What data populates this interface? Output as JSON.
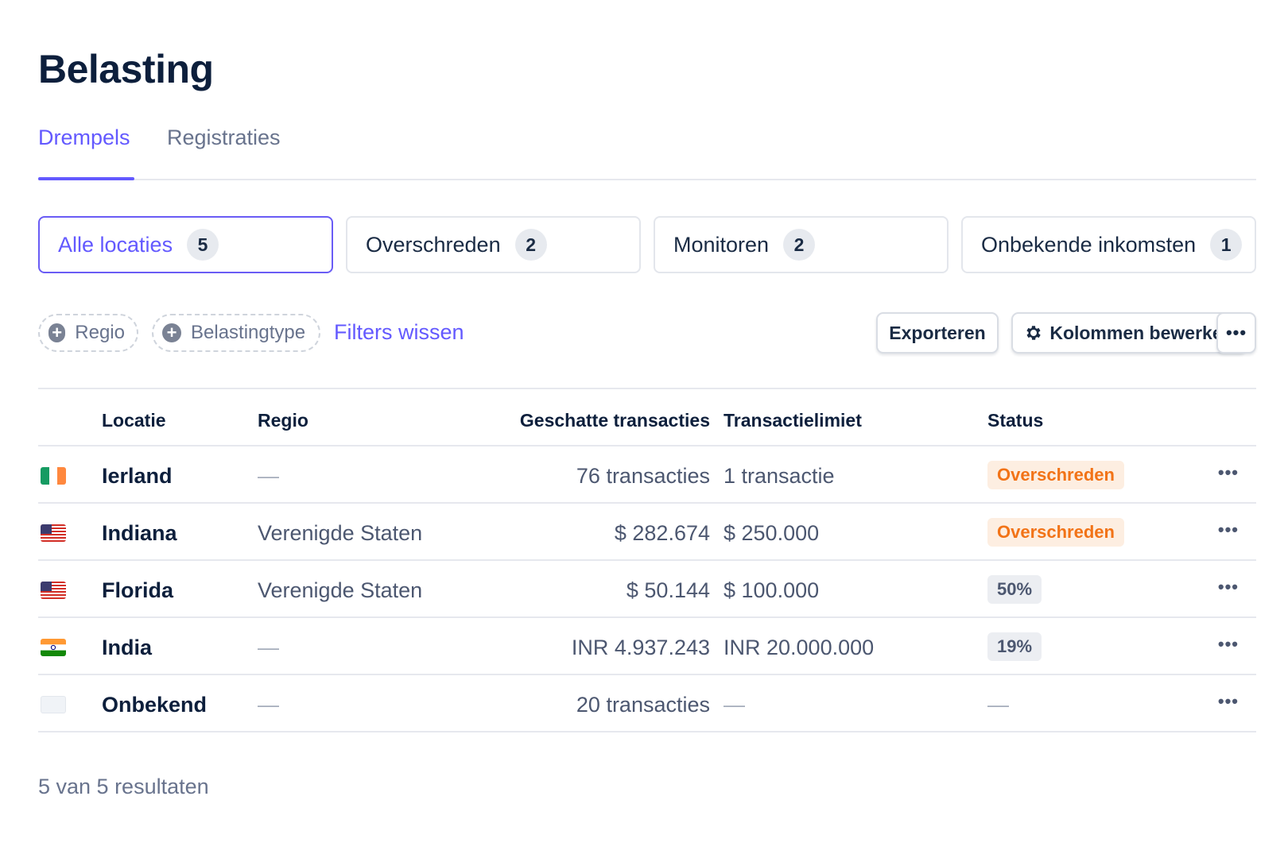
{
  "page": {
    "title": "Belasting"
  },
  "tabs": [
    {
      "label": "Drempels",
      "active": true
    },
    {
      "label": "Registraties",
      "active": false
    }
  ],
  "filter_cards": [
    {
      "label": "Alle locaties",
      "count": "5",
      "selected": true
    },
    {
      "label": "Overschreden",
      "count": "2",
      "selected": false
    },
    {
      "label": "Monitoren",
      "count": "2",
      "selected": false
    },
    {
      "label": "Onbekende inkomsten",
      "count": "1",
      "selected": false
    }
  ],
  "toolbar": {
    "chips": [
      {
        "label": "Regio",
        "icon": "plus-circle-icon"
      },
      {
        "label": "Belastingtype",
        "icon": "plus-circle-icon"
      }
    ],
    "clear_filters": "Filters wissen",
    "export_label": "Exporteren",
    "edit_columns_label": "Kolommen bewerken",
    "more_label": "•••"
  },
  "table": {
    "columns": [
      "Locatie",
      "Regio",
      "Geschatte transacties",
      "Transactielimiet",
      "Status"
    ],
    "rows": [
      {
        "flag": "ireland-flag-icon",
        "location": "Ierland",
        "region": "—",
        "estimated": "76 transacties",
        "limit": "1 transactie",
        "status": "Overschreden",
        "status_type": "exceeded"
      },
      {
        "flag": "us-flag-icon",
        "location": "Indiana",
        "region": "Verenigde Staten",
        "estimated": "$ 282.674",
        "limit": "$ 250.000",
        "status": "Overschreden",
        "status_type": "exceeded"
      },
      {
        "flag": "us-flag-icon",
        "location": "Florida",
        "region": "Verenigde Staten",
        "estimated": "$ 50.144",
        "limit": "$ 100.000",
        "status": "50%",
        "status_type": "pct"
      },
      {
        "flag": "india-flag-icon",
        "location": "India",
        "region": "—",
        "estimated": "INR 4.937.243",
        "limit": "INR 20.000.000",
        "status": "19%",
        "status_type": "pct"
      },
      {
        "flag": "unknown-flag-icon",
        "location": "Onbekend",
        "region": "—",
        "estimated": "20 transacties",
        "limit": "—",
        "status": "—",
        "status_type": "none"
      }
    ],
    "row_menu": "•••"
  },
  "footer": {
    "results": "5 van 5 resultaten"
  },
  "colors": {
    "accent": "#6359ff",
    "exceeded_text": "#f27317",
    "exceeded_bg": "#fdeee1",
    "border": "#e6e8ee"
  }
}
